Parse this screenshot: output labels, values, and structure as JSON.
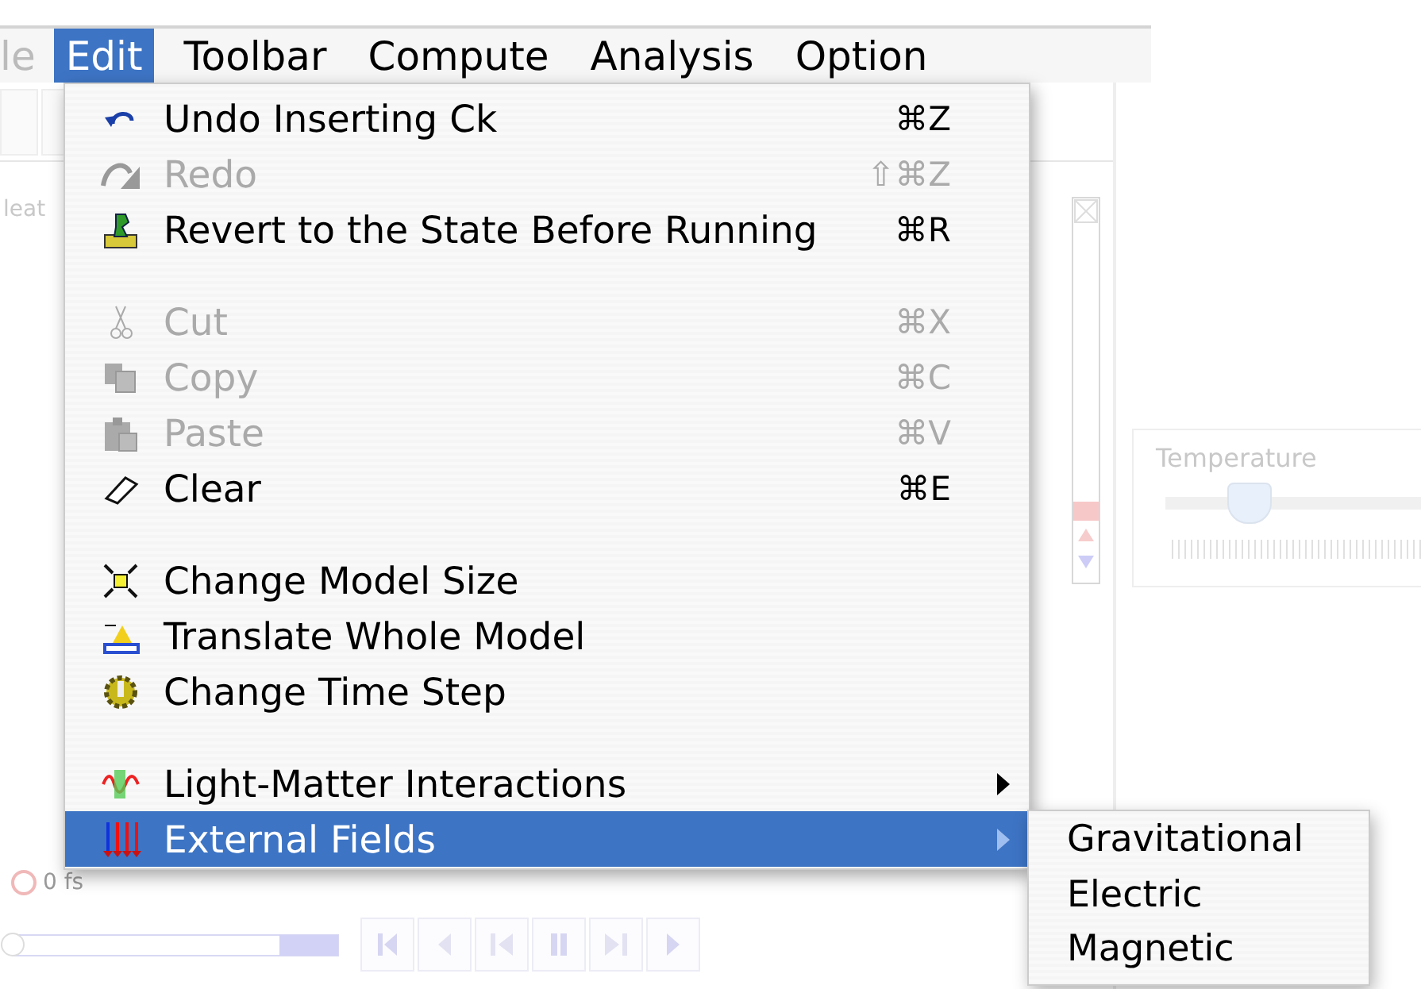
{
  "menubar": {
    "items": [
      {
        "label": "le",
        "selected": false
      },
      {
        "label": "Edit",
        "selected": true
      },
      {
        "label": "Toolbar",
        "selected": false
      },
      {
        "label": "Compute",
        "selected": false
      },
      {
        "label": "Analysis",
        "selected": false
      },
      {
        "label": "Option",
        "selected": false
      }
    ]
  },
  "edit_menu": {
    "groups": [
      [
        {
          "label": "Undo Inserting Ck",
          "shortcut": "⌘Z",
          "disabled": false,
          "selected": false,
          "submenu": false
        },
        {
          "label": "Redo",
          "shortcut": "⇧⌘Z",
          "disabled": true,
          "selected": false,
          "submenu": false
        },
        {
          "label": "Revert to the State Before Running",
          "shortcut": "⌘R",
          "disabled": false,
          "selected": false,
          "submenu": false
        }
      ],
      [
        {
          "label": "Cut",
          "shortcut": "⌘X",
          "disabled": true,
          "selected": false,
          "submenu": false
        },
        {
          "label": "Copy",
          "shortcut": "⌘C",
          "disabled": true,
          "selected": false,
          "submenu": false
        },
        {
          "label": "Paste",
          "shortcut": "⌘V",
          "disabled": true,
          "selected": false,
          "submenu": false
        },
        {
          "label": "Clear",
          "shortcut": "⌘E",
          "disabled": false,
          "selected": false,
          "submenu": false
        }
      ],
      [
        {
          "label": "Change Model Size",
          "disabled": false,
          "selected": false,
          "submenu": false
        },
        {
          "label": "Translate Whole Model",
          "disabled": false,
          "selected": false,
          "submenu": false
        },
        {
          "label": "Change Time Step",
          "disabled": false,
          "selected": false,
          "submenu": false
        }
      ],
      [
        {
          "label": "Light-Matter Interactions",
          "disabled": false,
          "selected": false,
          "submenu": true
        },
        {
          "label": "External Fields",
          "disabled": false,
          "selected": true,
          "submenu": true
        }
      ]
    ]
  },
  "submenu": {
    "items": [
      {
        "label": "Gravitational",
        "selected": false
      },
      {
        "label": "Electric",
        "selected": false
      },
      {
        "label": "Magnetic",
        "selected": false
      }
    ]
  },
  "background": {
    "side_label": "leat",
    "time_reading": "0 fs",
    "temperature": {
      "label": "Temperature",
      "level": 0.32
    },
    "playback_slider": {
      "level": 0
    }
  }
}
